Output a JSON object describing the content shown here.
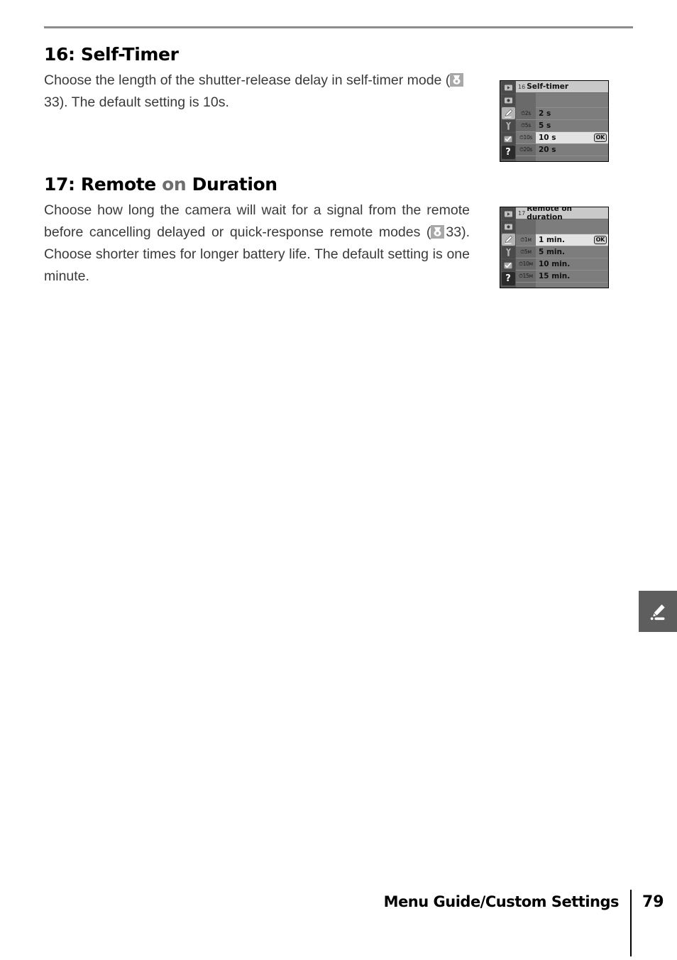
{
  "page": {
    "footer_title": "Menu Guide/Custom Settings",
    "page_number": "79"
  },
  "sections": [
    {
      "heading_prefix": "16: Self-Timer",
      "heading_main": "",
      "heading_tail": "",
      "body": "Choose the length of the shutter-release delay in self-timer mode ( 33).  The default setting is 10s.",
      "body_part1": "Choose the length of the shutter-release delay in self-timer mode (",
      "body_part2": "33).  The default setting is 10s.",
      "ref_icon": "self-timer-reference-icon"
    },
    {
      "heading_prefix": "17: Remote ",
      "heading_main": "on",
      "heading_tail": " Duration",
      "body_part1": "Choose how long the camera will wait for a signal from the remote before cancelling delayed or quick-response remote modes (",
      "body_part2": "33).  Choose shorter times for longer battery life.  The default setting is one minute.",
      "ref_icon": "self-timer-reference-icon"
    }
  ],
  "lcd_screens": [
    {
      "name": "self-timer-menu",
      "title_number": "16",
      "title": "Self-timer",
      "sidebar_icons": [
        {
          "name": "playback-icon",
          "glyph": "▶",
          "selected": false
        },
        {
          "name": "shooting-menu-icon",
          "glyph": "●",
          "selected": false
        },
        {
          "name": "custom-settings-pencil-icon",
          "glyph": "✎",
          "selected": true
        },
        {
          "name": "setup-wrench-icon",
          "glyph": "Υ",
          "selected": false
        },
        {
          "name": "retouch-check-icon",
          "glyph": "✓",
          "selected": false
        },
        {
          "name": "help-question-icon",
          "glyph": "?",
          "selected": false
        }
      ],
      "rows": [
        {
          "glyph": "⏱2s",
          "label": "2 s",
          "selected": false,
          "ok": false
        },
        {
          "glyph": "⏱5s",
          "label": "5 s",
          "selected": false,
          "ok": false
        },
        {
          "glyph": "⏱10s",
          "label": "10 s",
          "selected": true,
          "ok": true,
          "ok_label": "OK"
        },
        {
          "glyph": "⏱20s",
          "label": "20 s",
          "selected": false,
          "ok": false
        }
      ]
    },
    {
      "name": "remote-on-duration-menu",
      "title_number": "17",
      "title": "Remote on duration",
      "sidebar_icons": [
        {
          "name": "playback-icon",
          "glyph": "▶",
          "selected": false
        },
        {
          "name": "shooting-menu-icon",
          "glyph": "●",
          "selected": false
        },
        {
          "name": "custom-settings-pencil-icon",
          "glyph": "✎",
          "selected": true
        },
        {
          "name": "setup-wrench-icon",
          "glyph": "Υ",
          "selected": false
        },
        {
          "name": "retouch-check-icon",
          "glyph": "✓",
          "selected": false
        },
        {
          "name": "help-question-icon",
          "glyph": "?",
          "selected": false
        }
      ],
      "rows": [
        {
          "glyph": "⏱1м",
          "label": "1 min.",
          "selected": true,
          "ok": true,
          "ok_label": "OK"
        },
        {
          "glyph": "⏱5м",
          "label": "5 min.",
          "selected": false,
          "ok": false
        },
        {
          "glyph": "⏱10м",
          "label": "10 min.",
          "selected": false,
          "ok": false
        },
        {
          "glyph": "⏱15м",
          "label": "15 min.",
          "selected": false,
          "ok": false
        }
      ]
    }
  ],
  "thumb_tab": {
    "name": "custom-settings-thumb-tab",
    "icon": "pencil-icon"
  },
  "colors": {
    "rule": "#8c8c8c",
    "body_text": "#3a3a3a",
    "heading": "#000000",
    "heading_dim": "#6e6e6e",
    "tab_background": "#5e5e5e",
    "lcd_body": "#7d7d7d",
    "lcd_title": "#c9c9c9"
  }
}
